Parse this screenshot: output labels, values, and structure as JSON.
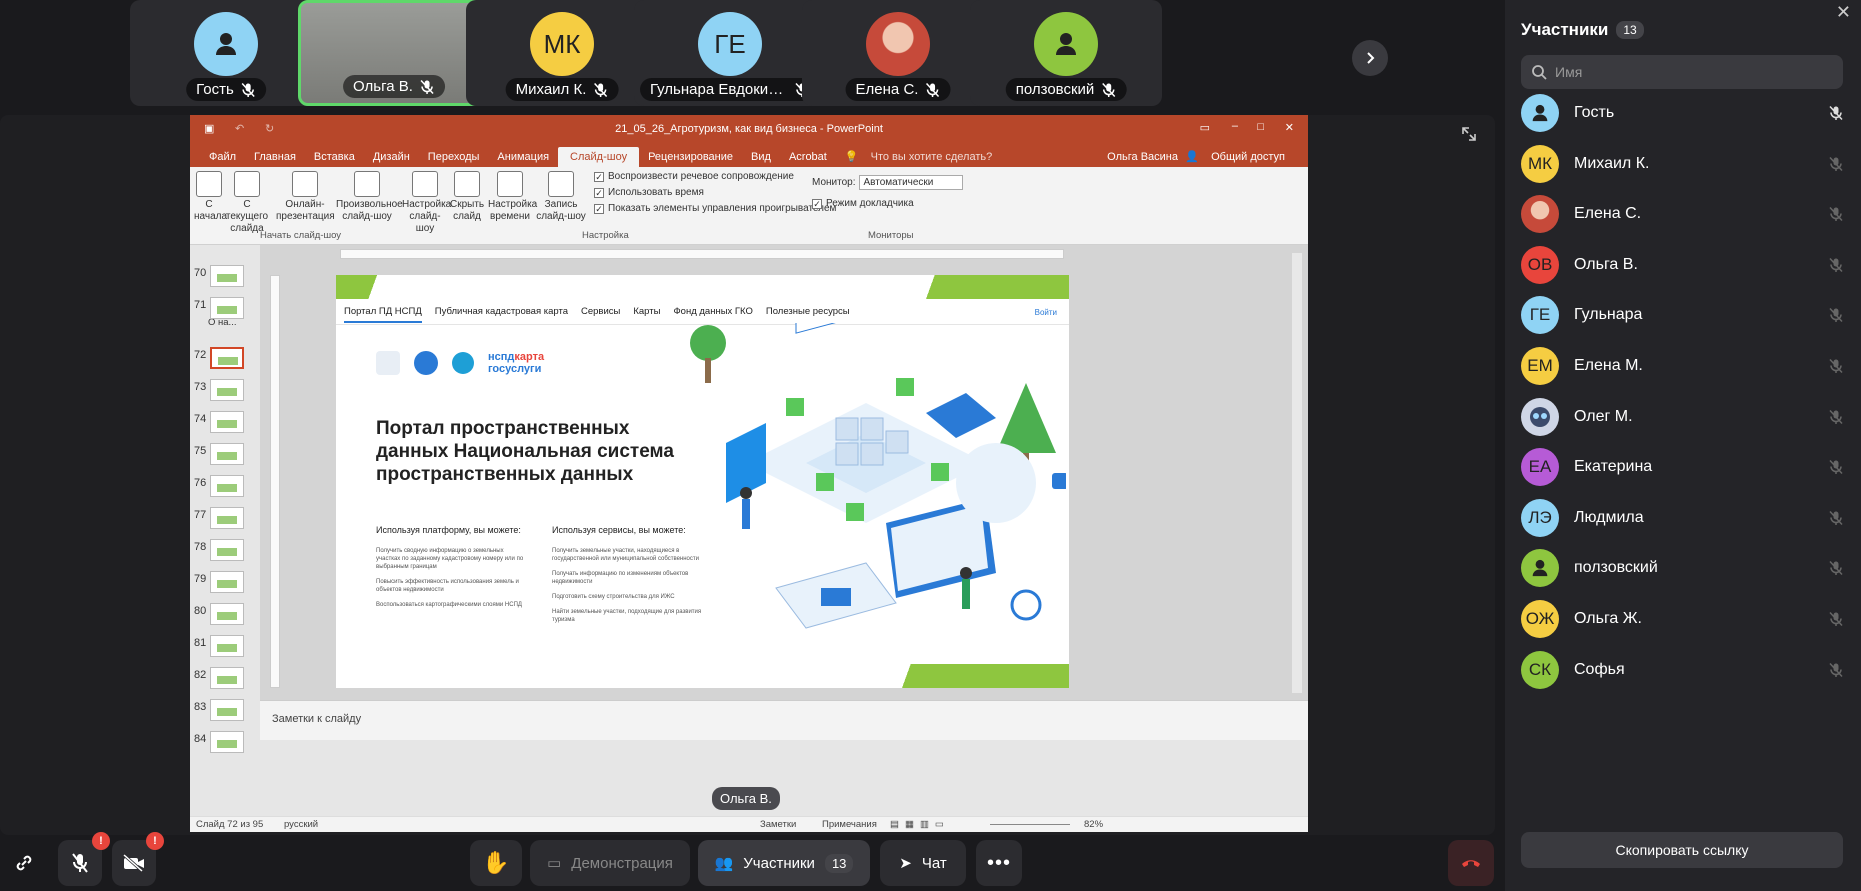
{
  "tiles": [
    {
      "name": "Гость",
      "initials": "",
      "color": "#8fd3f4",
      "kind": "person-icon"
    },
    {
      "name": "Ольга В.",
      "initials": "",
      "color": "#888",
      "kind": "photo"
    },
    {
      "name": "Михаил К.",
      "initials": "МК",
      "color": "#f5cd42",
      "kind": "initials"
    },
    {
      "name": "Гульнара Евдоким...",
      "initials": "ГЕ",
      "color": "#8fd3f4",
      "kind": "initials"
    },
    {
      "name": "Елена С.",
      "initials": "",
      "color": "#c64a3a",
      "kind": "photo-red"
    },
    {
      "name": "ползовский",
      "initials": "",
      "color": "#8ec63f",
      "kind": "person-icon"
    }
  ],
  "ppt": {
    "title": "21_05_26_Агротуризм, как вид бизнеса - PowerPoint",
    "tabs": [
      "Файл",
      "Главная",
      "Вставка",
      "Дизайн",
      "Переходы",
      "Анимация",
      "Слайд-шоу",
      "Рецензирование",
      "Вид",
      "Acrobat"
    ],
    "tell_me": "Что вы хотите сделать?",
    "user": "Ольга Васина",
    "share": "Общий доступ",
    "ribbon": {
      "b1": "С начала",
      "b2": "С текущего слайда",
      "b3": "Онлайн-презентация",
      "b4": "Произвольное слайд-шоу",
      "b5": "Настройка слайд-шоу",
      "b6": "Скрыть слайд",
      "b7": "Настройка времени",
      "b8": "Запись слайд-шоу",
      "c1": "Воспроизвести речевое сопровождение",
      "c2": "Использовать время",
      "c3": "Показать элементы управления проигрывателем",
      "monitor_label": "Монитор:",
      "monitor_value": "Автоматически",
      "presenter_mode": "Режим докладчика",
      "g1": "Начать слайд-шоу",
      "g2": "Настройка",
      "g3": "Мониторы"
    },
    "thumbs": [
      {
        "n": "70"
      },
      {
        "n": "71"
      },
      {
        "n": "72"
      },
      {
        "n": "73"
      },
      {
        "n": "74"
      },
      {
        "n": "75"
      },
      {
        "n": "76"
      },
      {
        "n": "77"
      },
      {
        "n": "78"
      },
      {
        "n": "79"
      },
      {
        "n": "80"
      },
      {
        "n": "81"
      },
      {
        "n": "82"
      },
      {
        "n": "83"
      },
      {
        "n": "84"
      }
    ],
    "section_label": "О на...",
    "slide": {
      "nav": [
        "Портал ПД НСПД",
        "Публичная кадастровая карта",
        "Сервисы",
        "Карты",
        "Фонд данных ГКО",
        "Полезные ресурсы"
      ],
      "login": "Войти",
      "logo_text1": "нспд",
      "logo_text2": "карта",
      "logo_text3": "госуслуги",
      "title": "Портал пространственных данных Национальная система пространственных данных",
      "col1_h": "Используя платформу, вы можете:",
      "col1": [
        "Получить сводную информацию о земельных участках по заданному кадастровому номеру или по выбранным границам",
        "Повысить эффективность использования земель и объектов недвижимости",
        "Воспользоваться картографическими слоями НСПД"
      ],
      "col2_h": "Используя сервисы, вы можете:",
      "col2": [
        "Получить земельные участки, находящиеся в государственной или муниципальной собственности",
        "Получать информацию по изменениям объектов недвижимости",
        "Подготовить схему строительства для ИЖС",
        "Найти земельные участки, подходящие для развития туризма"
      ]
    },
    "notes": "Заметки к слайду",
    "status": {
      "slide": "Слайд 72 из 95",
      "lang": "русский",
      "notes": "Заметки",
      "comments": "Примечания",
      "zoom": "82%"
    }
  },
  "presenter": "Ольга В.",
  "bottom": {
    "demo": "Демонстрация",
    "participants": "Участники",
    "count": "13",
    "chat": "Чат",
    "badge": "!"
  },
  "panel": {
    "title": "Участники",
    "count": "13",
    "search_placeholder": "Имя",
    "participants": [
      {
        "name": "Гость",
        "initials": "",
        "color": "#8fd3f4",
        "kind": "person"
      },
      {
        "name": "Михаил К.",
        "initials": "МК",
        "color": "#f5cd42",
        "kind": "initials"
      },
      {
        "name": "Елена С.",
        "initials": "",
        "color": "#c64a3a",
        "kind": "photo"
      },
      {
        "name": "Ольга В.",
        "initials": "ОВ",
        "color": "#e8453c",
        "kind": "initials"
      },
      {
        "name": "Гульнара",
        "initials": "ГЕ",
        "color": "#8fd3f4",
        "kind": "initials"
      },
      {
        "name": "Елена М.",
        "initials": "ЕМ",
        "color": "#f5cd42",
        "kind": "initials"
      },
      {
        "name": "Олег М.",
        "initials": "",
        "color": "#cfd6e6",
        "kind": "robot"
      },
      {
        "name": "Екатерина",
        "initials": "ЕА",
        "color": "#b65bd6",
        "kind": "initials"
      },
      {
        "name": "Людмила",
        "initials": "ЛЭ",
        "color": "#8fd3f4",
        "kind": "initials"
      },
      {
        "name": "ползовский",
        "initials": "",
        "color": "#8ec63f",
        "kind": "person"
      },
      {
        "name": "Ольга Ж.",
        "initials": "ОЖ",
        "color": "#f5cd42",
        "kind": "initials"
      },
      {
        "name": "Софья",
        "initials": "СК",
        "color": "#8ec63f",
        "kind": "initials"
      }
    ],
    "copy_link": "Скопировать ссылку"
  }
}
